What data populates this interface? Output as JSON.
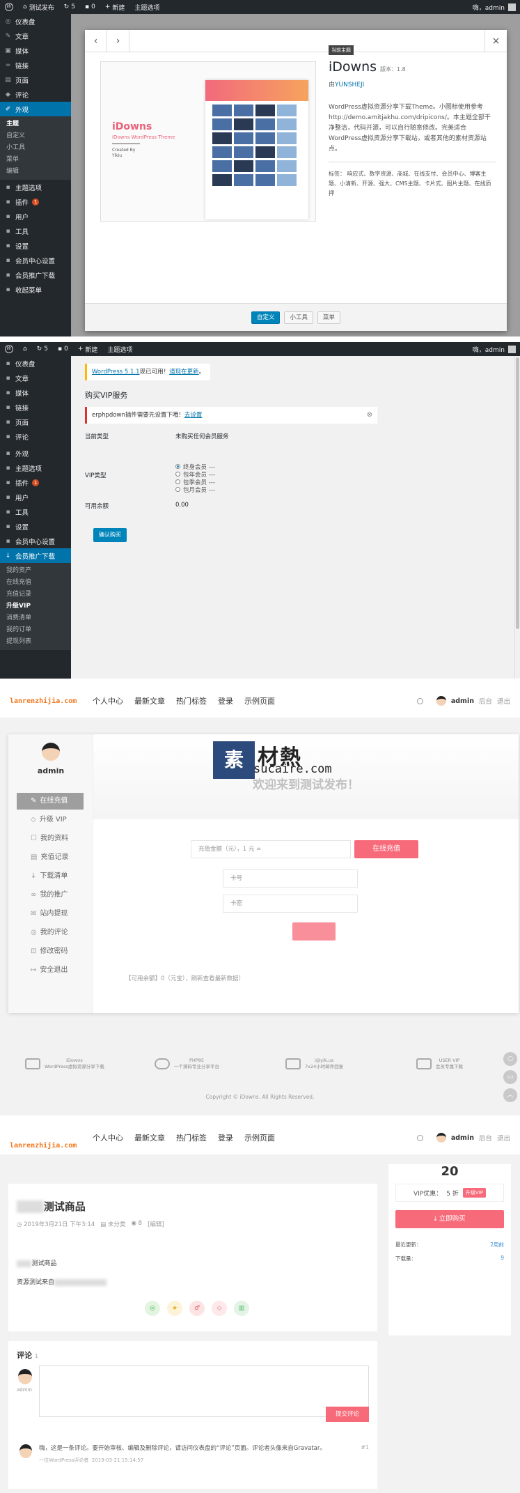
{
  "p1": {
    "adminbar": {
      "comments": "0",
      "updates": "5",
      "new": "新建",
      "theme_opts": "主题选项",
      "site": "测试发布",
      "greeting": "嗨，admin"
    },
    "sidebar": [
      {
        "icon": "dashboard-icon",
        "glyph": "◎",
        "label": "仪表盘"
      },
      {
        "icon": "pin-icon",
        "glyph": "✎",
        "label": "文章"
      },
      {
        "icon": "media-icon",
        "glyph": "▣",
        "label": "媒体"
      },
      {
        "icon": "link-icon",
        "glyph": "∞",
        "label": "链接"
      },
      {
        "icon": "page-icon",
        "glyph": "▤",
        "label": "页面"
      },
      {
        "icon": "comment-icon",
        "glyph": "◆",
        "label": "评论"
      }
    ],
    "appearance": "外观",
    "appearance_sub": [
      "主题",
      "自定义",
      "小工具",
      "菜单",
      "编辑"
    ],
    "sidebar2": [
      {
        "label": "主题选项"
      },
      {
        "label": "插件",
        "badge": "1"
      },
      {
        "label": "用户"
      },
      {
        "label": "工具"
      },
      {
        "label": "设置"
      },
      {
        "label": "会员中心设置"
      },
      {
        "label": "会员推广下载"
      },
      {
        "label": "收起菜单"
      }
    ],
    "modal": {
      "current_tag": "当前主题",
      "theme_name": "iDowns",
      "version": "版本：1.8",
      "author_prefix": "由",
      "author": "YUNSHEJI",
      "desc": "WordPress虚拟资源分享下载Theme。小图标使用参考http://demo.amitjakhu.com/dripicons/。本主题全部干净整洁，代码开源，可以自行随意修改。完美适合WordPress虚拟资源分享下载站，或者其他的素材资源站点。",
      "tags": "标签： 响应式、数字资源、商城、在线支付、会员中心、博客主题、小清新、开源、强大、CMS主题、卡片式、图片主题、在线质押",
      "preview_brand": "iDowns",
      "preview_sub": "iDowns WordPress Theme",
      "preview_by": "Created By",
      "preview_by2": "Yikiu",
      "btn_customize": "自定义",
      "btn_widgets": "小工具",
      "btn_menu": "菜单"
    }
  },
  "p2": {
    "adminbar": {
      "comments": "0",
      "updates": "5",
      "new": "新建",
      "theme_opts": "主题选项",
      "greeting": "嗨，admin"
    },
    "sidebar": [
      {
        "label": "仪表盘"
      },
      {
        "label": "文章"
      },
      {
        "label": "媒体"
      },
      {
        "label": "链接"
      },
      {
        "label": "页面"
      },
      {
        "label": "评论"
      },
      {
        "label": "外观"
      },
      {
        "label": "主题选项"
      },
      {
        "label": "插件",
        "badge": "1"
      },
      {
        "label": "用户"
      },
      {
        "label": "工具"
      },
      {
        "label": "设置"
      },
      {
        "label": "会员中心设置"
      }
    ],
    "active": "会员推广下载",
    "sub": [
      "我的资产",
      "在线充值",
      "充值记录",
      "升级VIP",
      "消费清单",
      "我的订单",
      "提现列表"
    ],
    "notice_link": "WordPress 5.1.1",
    "notice_mid": "现已可用！",
    "notice_link2": "请现在更新",
    "notice_end": "。",
    "heading": "购买VIP服务",
    "alert": "erphpdown插件需要先设置下哦！",
    "alert_link": "去设置",
    "row1_label": "当前类型",
    "row1_value": "未购买任何会员服务",
    "row2_label": "VIP类型",
    "options": [
      "终身会员 ---",
      "包年会员 ---",
      "包季会员 ---",
      "包月会员 ---"
    ],
    "row3_label": "可用余额",
    "row3_value": "0.00",
    "buy_btn": "确认购买"
  },
  "front": {
    "logo": "lanrenzhijia.com",
    "nav": [
      "个人中心",
      "最新文章",
      "热门标签",
      "登录",
      "示例页面"
    ],
    "user": "admin",
    "backend": "后台",
    "logout": "退出"
  },
  "p3": {
    "username": "admin",
    "menu": [
      {
        "glyph": "✎",
        "label": "在线充值"
      },
      {
        "glyph": "◇",
        "label": "升级 VIP"
      },
      {
        "glyph": "☐",
        "label": "我的资料"
      },
      {
        "glyph": "▤",
        "label": "充值记录"
      },
      {
        "glyph": "↓",
        "label": "下载清单"
      },
      {
        "glyph": "∞",
        "label": "我的推广"
      },
      {
        "glyph": "✉",
        "label": "站内提现"
      },
      {
        "glyph": "◎",
        "label": "我的评论"
      },
      {
        "glyph": "⊡",
        "label": "修改密码"
      },
      {
        "glyph": "↦",
        "label": "安全退出"
      }
    ],
    "welcome": "欢迎来到测试发布！",
    "watermark_cn": "素",
    "watermark_cn2": "材熱",
    "watermark_en": "sucaire.com",
    "amount_placeholder": "充值金额（元），1 元 =",
    "recharge_btn": "在线充值",
    "card_no": "卡号",
    "card_pwd": "卡密",
    "balance": "【可用余额】0（元宝），刷新查看最新数据）",
    "features": [
      {
        "title": "iDowns",
        "sub": "WordPress虚拟资源分享下载"
      },
      {
        "title": "PHP85",
        "sub": "一个源码专业分享平台"
      },
      {
        "title": "i@yik.us",
        "sub": "7x24小时邮件回复"
      },
      {
        "title": "USER VIP",
        "sub": "会员专属下载"
      }
    ],
    "copyright": "Copyright © iDowns. All Rights Reserved."
  },
  "p4": {
    "title": "测试商品",
    "date": "2019年3月21日 下午3:14",
    "category": "未分类",
    "views": "8",
    "edit": "[编辑]",
    "text1": "测试商品",
    "text2": "资源测试来自",
    "price": "20",
    "vip_label": "VIP优惠：",
    "vip_discount": "5 折",
    "vip_tag": "升级VIP",
    "buy": "立即购买",
    "last_update_label": "最近更新：",
    "last_update": "2周前",
    "downloads_label": "下载量：",
    "downloads": "9",
    "comments_title": "评论",
    "comments_count": "1",
    "commenter": "admin",
    "submit": "提交评论",
    "c1_text": "嗨，这是一条评论。要开始审核、编辑及删除评论，请访问仪表盘的“评论”页面。评论者头像来自Gravatar。",
    "c1_author": "一位WordPress评论者",
    "c1_time": "2019-03-21 15:14:57",
    "c1_num": "#1"
  }
}
